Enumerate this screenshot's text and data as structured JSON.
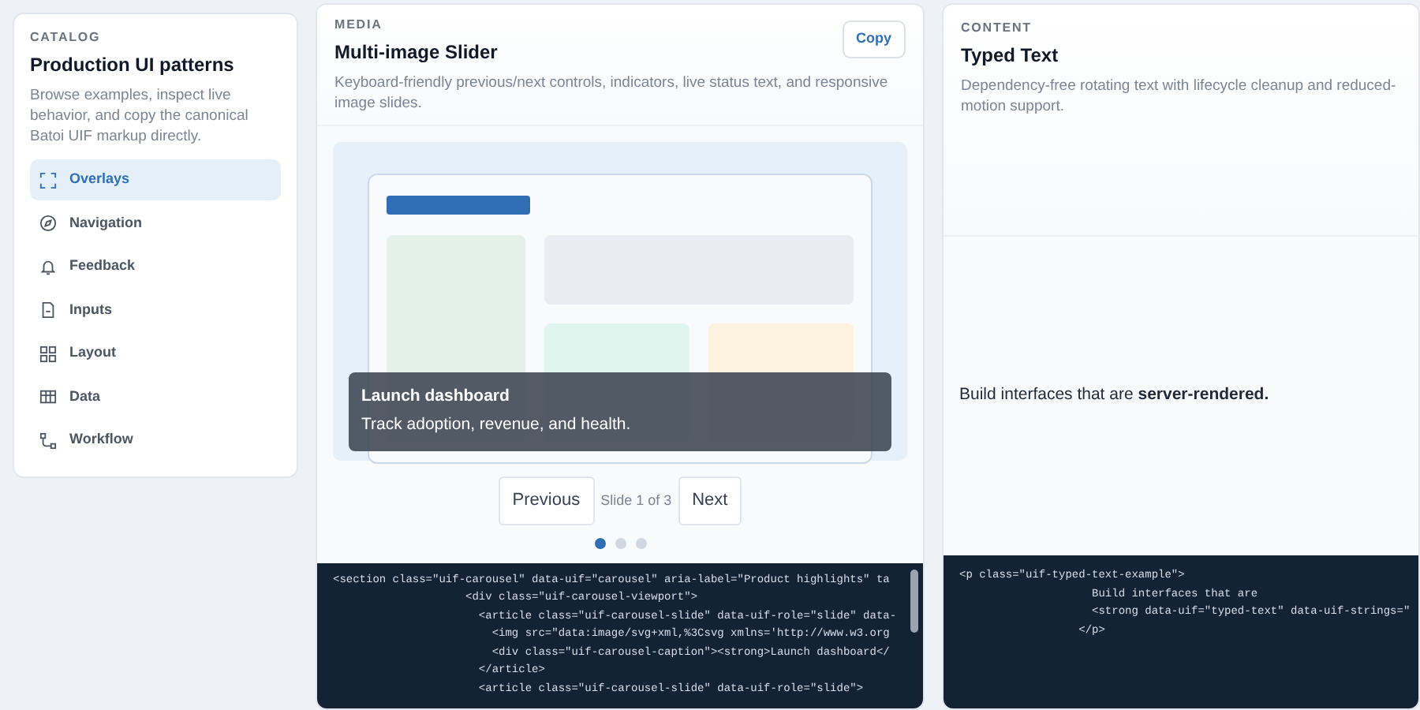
{
  "sidebar": {
    "eyebrow": "CATALOG",
    "title": "Production UI patterns",
    "description": "Browse examples, inspect live behavior, and copy the canonical Batoi UIF markup directly.",
    "items": [
      {
        "label": "Overlays",
        "selected": true
      },
      {
        "label": "Navigation",
        "selected": false
      },
      {
        "label": "Feedback",
        "selected": false
      },
      {
        "label": "Inputs",
        "selected": false
      },
      {
        "label": "Layout",
        "selected": false
      },
      {
        "label": "Data",
        "selected": false
      },
      {
        "label": "Workflow",
        "selected": false
      }
    ]
  },
  "media_card": {
    "eyebrow": "MEDIA",
    "title": "Multi-image Slider",
    "description": "Keyboard-friendly previous/next controls, indicators, live status text, and responsive image slides.",
    "copy_button": "Copy",
    "slide": {
      "caption_title": "Launch dashboard",
      "caption_text": "Track adoption, revenue, and health."
    },
    "previous_button": "Previous",
    "status": "Slide 1 of 3",
    "next_button": "Next",
    "indicators": [
      {
        "selected": true
      },
      {
        "selected": false
      },
      {
        "selected": false
      }
    ],
    "code_lines": [
      "<section class=\"uif-carousel\" data-uif=\"carousel\" aria-label=\"Product highlights\" ta",
      "                    <div class=\"uif-carousel-viewport\">",
      "                      <article class=\"uif-carousel-slide\" data-uif-role=\"slide\" data-",
      "                        <img src=\"data:image/svg+xml,%3Csvg xmlns='http://www.w3.org",
      "                        <div class=\"uif-carousel-caption\"><strong>Launch dashboard</",
      "                      </article>",
      "                      <article class=\"uif-carousel-slide\" data-uif-role=\"slide\">"
    ]
  },
  "content_card": {
    "eyebrow": "CONTENT",
    "title": "Typed Text",
    "description": "Dependency-free rotating text with lifecycle cleanup and reduced-motion support.",
    "demo_text": "Build interfaces that are **server-rendered.**",
    "code_lines": [
      "<p class=\"uif-typed-text-example\">",
      "                    Build interfaces that are",
      "                    <strong data-uif=\"typed-text\" data-uif-strings=\"",
      "                  </p>"
    ]
  }
}
